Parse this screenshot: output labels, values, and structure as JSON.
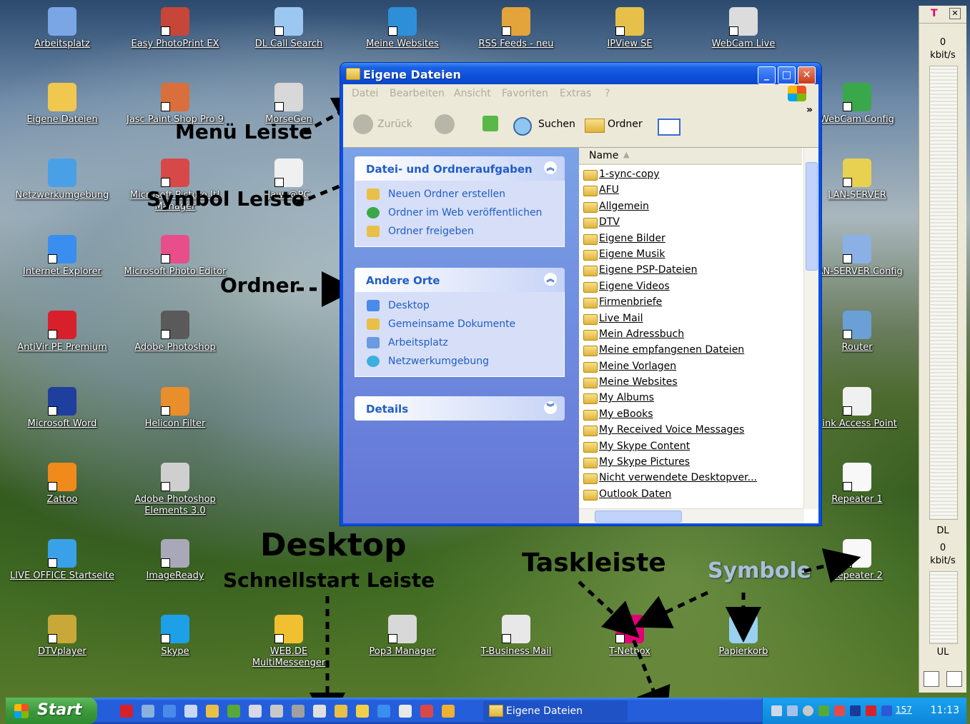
{
  "desktop_icons": [
    {
      "label": "Arbeitsplatz",
      "icon": "computer-icon",
      "color": "#7aa6e6"
    },
    {
      "label": "Easy PhotoPrint EX",
      "icon": "printer-icon",
      "color": "#c7463a"
    },
    {
      "label": "DL Call Search",
      "icon": "magnifier-icon",
      "color": "#9cc7f0"
    },
    {
      "label": "Meine Websites",
      "icon": "globe-icon",
      "color": "#2e8fd6"
    },
    {
      "label": "RSS Feeds - neu",
      "icon": "cursor-icon",
      "color": "#e3a43b"
    },
    {
      "label": "IPView SE",
      "icon": "camera-icon",
      "color": "#e6c04a"
    },
    {
      "label": "WebCam Live",
      "icon": "webcam-icon",
      "color": "#dcdcdc"
    },
    {
      "label": "Eigene Dateien",
      "icon": "documents-folder-icon",
      "color": "#f0c850"
    },
    {
      "label": "Jasc Paint Shop Pro 9",
      "icon": "palette-icon",
      "color": "#d86f3d"
    },
    {
      "label": "MorseGen",
      "icon": "ear-icon",
      "color": "#d8d8d8"
    },
    {
      "label": "WebCam Config",
      "icon": "webcam-config-icon",
      "color": "#3aa84a"
    },
    {
      "label": "Netzwerkumgebung",
      "icon": "network-icon",
      "color": "#4aa0e6"
    },
    {
      "label": "Microsoft Picture It! Manager",
      "icon": "picture-manager-icon",
      "color": "#d84848"
    },
    {
      "label": "Jaws@PC",
      "icon": "compass-icon",
      "color": "#f0f0f0"
    },
    {
      "label": "LAN-SERVER",
      "icon": "server-icon",
      "color": "#e8d050"
    },
    {
      "label": "Internet Explorer",
      "icon": "ie-icon",
      "color": "#3a8ef0"
    },
    {
      "label": "Microsoft Photo Editor",
      "icon": "photo-editor-icon",
      "color": "#e84e8a"
    },
    {
      "label": "LAN-SERVER Config",
      "icon": "server-config-icon",
      "color": "#8ab0e6"
    },
    {
      "label": "AntiVir PE Premium",
      "icon": "antivir-icon",
      "color": "#d8202a"
    },
    {
      "label": "Adobe Photoshop",
      "icon": "eye-icon",
      "color": "#5a5a5a"
    },
    {
      "label": "Router",
      "icon": "router-icon",
      "color": "#6aa0d6"
    },
    {
      "label": "Microsoft Word",
      "icon": "word-icon",
      "color": "#1f3f9f"
    },
    {
      "label": "Helicon Filter",
      "icon": "helicon-icon",
      "color": "#e88e2a"
    },
    {
      "label": "Link Access Point",
      "icon": "antenna-icon",
      "color": "#f0f0f0"
    },
    {
      "label": "Zattoo",
      "icon": "tv-icon",
      "color": "#f08a1a"
    },
    {
      "label": "Adobe Photoshop Elements 3.0",
      "icon": "photo-elements-icon",
      "color": "#cfcfcf"
    },
    {
      "label": "Repeater 1",
      "icon": "wireless-icon",
      "color": "#f8f8f8"
    },
    {
      "label": "LIVE OFFICE Startseite",
      "icon": "live-office-icon",
      "color": "#3aa0e8"
    },
    {
      "label": "ImageReady",
      "icon": "gear-image-icon",
      "color": "#a8a8b8"
    },
    {
      "label": "Repeater 2",
      "icon": "wireless-icon",
      "color": "#f8f8f8"
    },
    {
      "label": "DTVplayer",
      "icon": "dvr-icon",
      "color": "#c8a838"
    },
    {
      "label": "Skype",
      "icon": "skype-icon",
      "color": "#1ea0e8"
    },
    {
      "label": "WEB.DE MultiMessenger",
      "icon": "messenger-icon",
      "color": "#f0c030"
    },
    {
      "label": "Pop3 Manager",
      "icon": "trash-can-icon",
      "color": "#d8d8d8"
    },
    {
      "label": "T-Business Mail",
      "icon": "mail-icon",
      "color": "#e8e8e8"
    },
    {
      "label": "T-Netbox",
      "icon": "telekom-icon",
      "color": "#e20074"
    },
    {
      "label": "Papierkorb",
      "icon": "recycle-bin-icon",
      "color": "#9ad0f0"
    }
  ],
  "annotations": {
    "menu_leiste": "Menü Leiste",
    "symbol_leiste": "Symbol Leiste",
    "ordner": "Ordner",
    "desktop": "Desktop",
    "schnellstart": "Schnellstart Leiste",
    "taskleiste": "Taskleiste",
    "symbole": "Symbole"
  },
  "window": {
    "title": "Eigene Dateien",
    "menu": [
      "Datei",
      "Bearbeiten",
      "Ansicht",
      "Favoriten",
      "Extras",
      "?"
    ],
    "toolbar": {
      "back": "Zurück",
      "search": "Suchen",
      "folders": "Ordner",
      "more": "»"
    },
    "tasks_panel": {
      "title": "Datei- und Ordneraufgaben",
      "items": [
        "Neuen Ordner erstellen",
        "Ordner im Web veröffentlichen",
        "Ordner freigeben"
      ]
    },
    "places_panel": {
      "title": "Andere Orte",
      "items": [
        "Desktop",
        "Gemeinsame Dokumente",
        "Arbeitsplatz",
        "Netzwerkumgebung"
      ]
    },
    "details_panel": {
      "title": "Details"
    },
    "column_name": "Name",
    "files": [
      "1-sync-copy",
      "AFU",
      "Allgemein",
      "DTV",
      "Eigene Bilder",
      "Eigene Musik",
      "Eigene PSP-Dateien",
      "Eigene Videos",
      "Firmenbriefe",
      "Live Mail",
      "Mein Adressbuch",
      "Meine empfangenen Dateien",
      "Meine Vorlagen",
      "Meine Websites",
      "My Albums",
      "My eBooks",
      "My Received Voice Messages",
      "My Skype Content",
      "My Skype Pictures",
      "Nicht verwendete Desktopver...",
      "Outlook Daten"
    ]
  },
  "taskbar": {
    "start": "Start",
    "task_item": "Eigene Dateien",
    "clock": "11:13",
    "tray_badge": "157"
  },
  "meter": {
    "dl_value": "0",
    "dl_unit": "kbit/s",
    "dl_label": "DL",
    "ul_value": "0",
    "ul_unit": "kbit/s",
    "ul_label": "UL"
  }
}
